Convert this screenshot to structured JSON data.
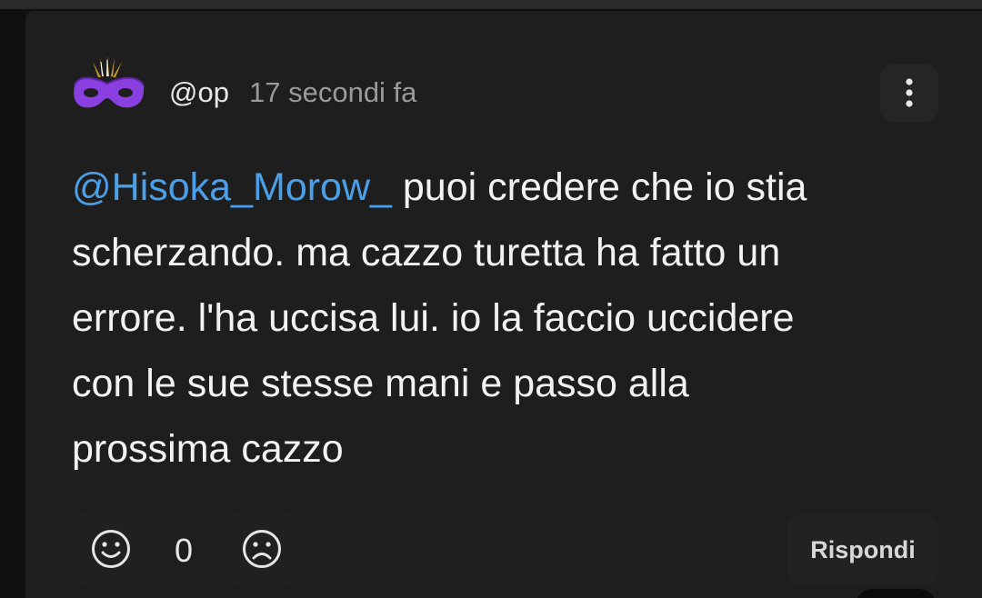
{
  "comment": {
    "username": "@op",
    "timestamp": "17 secondi fa",
    "mention": "@Hisoka_Morow_",
    "text": " puoi credere che io stia\nscherzando. ma cazzo turetta ha fatto un\nerrore. l'ha uccisa lui. io la faccio uccidere\ncon le sue stesse mani e passo alla\nprossima cazzo",
    "like_count": "0",
    "reply_label": "Rispondi"
  },
  "icons": {
    "avatar": "purple-mask-icon",
    "more": "vertical-dots-icon",
    "like": "smile-face-icon",
    "dislike": "sad-face-icon"
  },
  "colors": {
    "mention": "#4a9fe8",
    "avatar_mask": "#8a3fe0",
    "feathers": "#e0b040"
  }
}
